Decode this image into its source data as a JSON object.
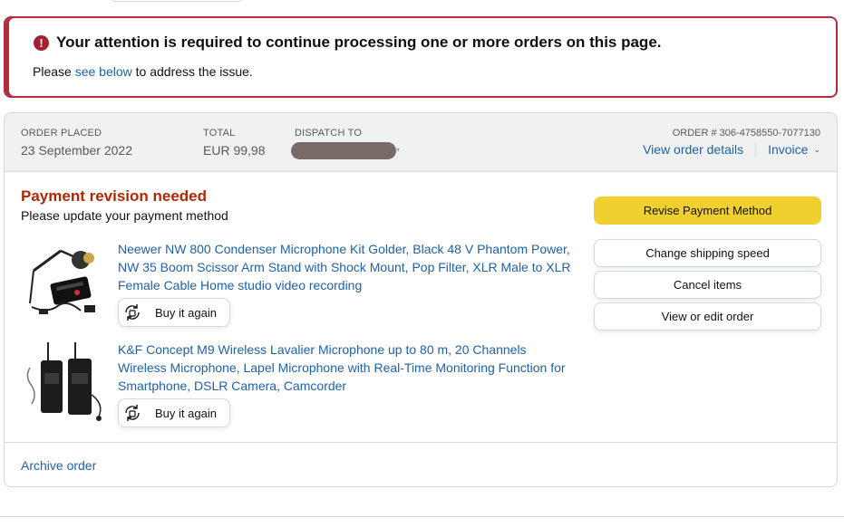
{
  "alert": {
    "icon": "exclamation-icon",
    "heading": "Your attention is required to continue processing one or more orders on this page.",
    "body_prefix": "Please",
    "body_link": "see below",
    "body_suffix": "to address the issue.",
    "border_color": "#b12c3f"
  },
  "order": {
    "placed_label": "ORDER PLACED",
    "placed_value": "23 September 2022",
    "total_label": "TOTAL",
    "total_value": "EUR 99,98",
    "dispatch_label": "DISPATCH TO",
    "order_number": "ORDER # 306-4758550-7077130",
    "view_details": "View order details",
    "invoice": "Invoice"
  },
  "status": {
    "title": "Payment revision needed",
    "subtitle": "Please update your payment method",
    "title_color": "#b12704"
  },
  "items": [
    {
      "title": "Neewer NW 800 Condenser Microphone Kit Golder, Black 48 V Phantom Power, NW 35 Boom Scissor Arm Stand with Shock Mount, Pop Filter, XLR Male to XLR Female Cable Home studio video recording",
      "buy_again": "Buy it again"
    },
    {
      "title": "K&F Concept M9 Wireless Lavalier Microphone up to 80 m, 20 Channels Wireless Microphone, Lapel Microphone with Real-Time Monitoring Function for Smartphone, DSLR Camera, Camcorder",
      "buy_again": "Buy it again"
    }
  ],
  "actions": {
    "revise_payment": "Revise Payment Method",
    "change_shipping": "Change shipping speed",
    "cancel_items": "Cancel items",
    "view_edit": "View or edit order",
    "primary_color": "#f0d02f"
  },
  "footer": {
    "archive": "Archive order"
  }
}
